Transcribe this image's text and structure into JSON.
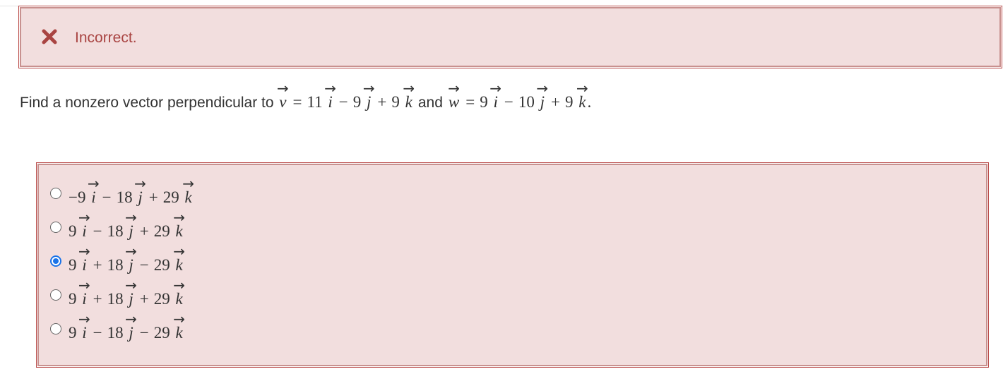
{
  "feedback": {
    "status_text": "Incorrect.",
    "icon": "close-icon",
    "color": "#a94442",
    "background": "#f2dede"
  },
  "question": {
    "prefix": "Find a nonzero vector perpendicular to",
    "v_name": "v",
    "equals": "=",
    "v_c1": "11",
    "v_op2": "−",
    "v_c2": "9",
    "v_op3": "+",
    "v_c3": "9",
    "and": "and",
    "w_name": "w",
    "w_c1": "9",
    "w_op2": "−",
    "w_c2": "10",
    "w_op3": "+",
    "w_c3": "9",
    "end": "."
  },
  "basis": {
    "i": "i",
    "j": "j",
    "k": "k"
  },
  "options": [
    {
      "c1": "−9",
      "op2": "−",
      "c2": "18",
      "op3": "+",
      "c3": "29",
      "selected": false
    },
    {
      "c1": "9",
      "op2": "−",
      "c2": "18",
      "op3": "+",
      "c3": "29",
      "selected": false
    },
    {
      "c1": "9",
      "op2": "+",
      "c2": "18",
      "op3": "−",
      "c3": "29",
      "selected": true
    },
    {
      "c1": "9",
      "op2": "+",
      "c2": "18",
      "op3": "+",
      "c3": "29",
      "selected": false
    },
    {
      "c1": "9",
      "op2": "−",
      "c2": "18",
      "op3": "−",
      "c3": "29",
      "selected": false
    }
  ],
  "colors": {
    "accent": "#1a73e8",
    "error": "#a94442",
    "error_bg": "#f2dede"
  }
}
